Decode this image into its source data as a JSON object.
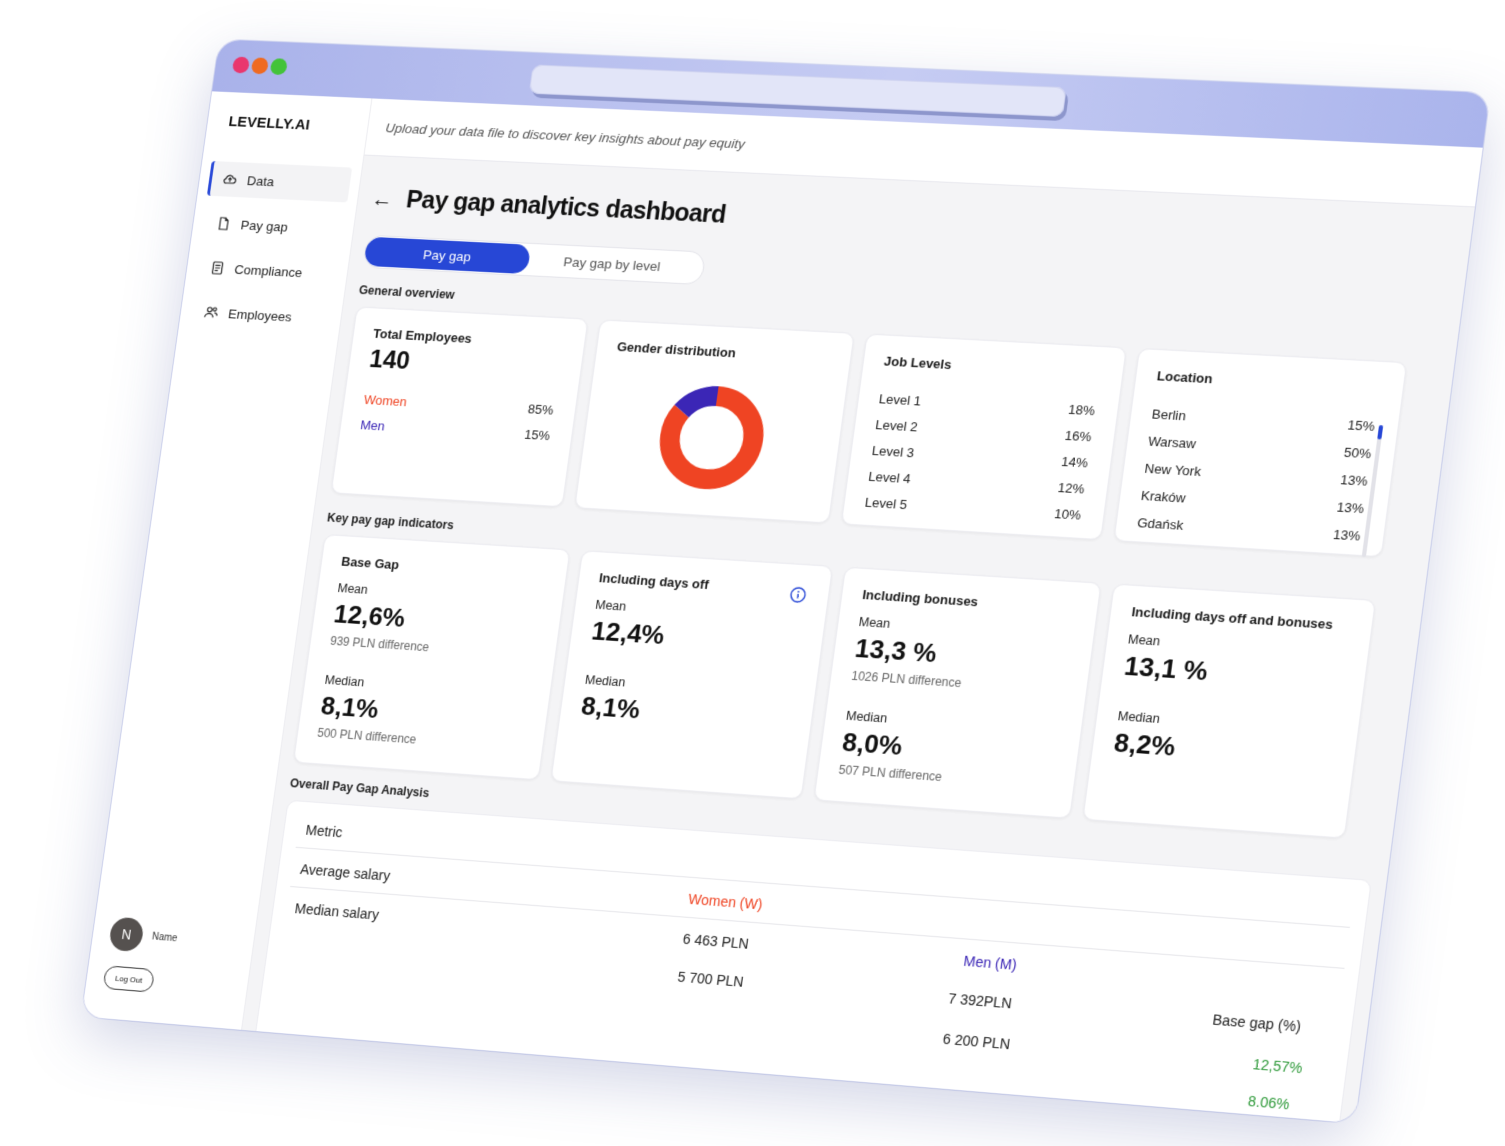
{
  "app": {
    "logo": "LEVELLY.AI",
    "subheader": "Upload your data file to discover key insights about pay equity"
  },
  "sidebar": {
    "items": [
      {
        "label": "Data",
        "icon": "cloud-upload-icon",
        "active": true
      },
      {
        "label": "Pay gap",
        "icon": "document-icon",
        "active": false
      },
      {
        "label": "Compliance",
        "icon": "checklist-icon",
        "active": false
      },
      {
        "label": "Employees",
        "icon": "users-icon",
        "active": false
      }
    ],
    "user": {
      "initial": "N",
      "name": "Name"
    },
    "logout_label": "Log Out"
  },
  "page": {
    "title": "Pay gap analytics dashboard"
  },
  "tabs": [
    {
      "label": "Pay gap",
      "active": true
    },
    {
      "label": "Pay gap by level",
      "active": false
    }
  ],
  "overview": {
    "label": "General overview",
    "total": {
      "title": "Total Employees",
      "value": "140",
      "rows": [
        {
          "label": "Women",
          "value": "85%"
        },
        {
          "label": "Men",
          "value": "15%"
        }
      ]
    },
    "gender": {
      "title": "Gender distribution",
      "women_share": 0.85,
      "men_share": 0.15,
      "women_color": "#ef4423",
      "men_color": "#3b26b6"
    },
    "job_levels": {
      "title": "Job Levels",
      "rows": [
        {
          "label": "Level 1",
          "value": "18%"
        },
        {
          "label": "Level 2",
          "value": "16%"
        },
        {
          "label": "Level 3",
          "value": "14%"
        },
        {
          "label": "Level 4",
          "value": "12%"
        },
        {
          "label": "Level 5",
          "value": "10%"
        }
      ]
    },
    "location": {
      "title": "Location",
      "rows": [
        {
          "label": "Berlin",
          "value": "15%"
        },
        {
          "label": "Warsaw",
          "value": "50%"
        },
        {
          "label": "New York",
          "value": "13%"
        },
        {
          "label": "Kraków",
          "value": "13%"
        },
        {
          "label": "Gdańsk",
          "value": "13%"
        }
      ]
    }
  },
  "indicators": {
    "label": "Key pay gap indicators",
    "cards": [
      {
        "title": "Base Gap",
        "mean_label": "Mean",
        "mean": "12,6%",
        "mean_diff": "939 PLN difference",
        "median_label": "Median",
        "median": "8,1%",
        "median_diff": "500 PLN difference"
      },
      {
        "title": "Including days off",
        "mean_label": "Mean",
        "mean": "12,4%",
        "mean_diff": "",
        "median_label": "Median",
        "median": "8,1%",
        "median_diff": ""
      },
      {
        "title": "Including bonuses",
        "mean_label": "Mean",
        "mean": "13,3 %",
        "mean_diff": "1026  PLN difference",
        "median_label": "Median",
        "median": "8,0%",
        "median_diff": "507 PLN difference"
      },
      {
        "title": "Including days off and bonuses",
        "mean_label": "Mean",
        "mean": "13,1 %",
        "mean_diff": "",
        "median_label": "Median",
        "median": "8,2%",
        "median_diff": ""
      }
    ]
  },
  "analysis": {
    "label": "Overall Pay Gap Analysis",
    "headers": {
      "metric": "Metric",
      "women": "Women (W)",
      "men": "Men (M)",
      "gap": "Base gap (%)"
    },
    "rows": [
      {
        "metric": "Average salary",
        "women": "6 463 PLN",
        "men": "7 392PLN",
        "gap": "12,57%"
      },
      {
        "metric": "Median salary",
        "women": "5 700 PLN",
        "men": "6 200 PLN",
        "gap": "8.06%"
      }
    ],
    "colors": {
      "women": "#ef4423",
      "men": "#3b26b6",
      "gap": "#2f9a3a"
    }
  }
}
